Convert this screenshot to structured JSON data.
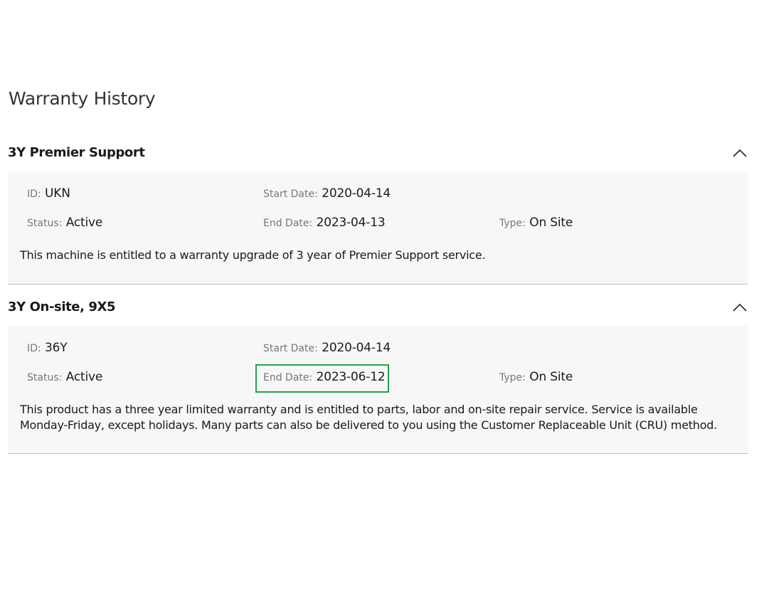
{
  "page": {
    "title": "Warranty History"
  },
  "warranties": [
    {
      "title": "3Y Premier Support",
      "id_label": "ID",
      "id_value": "UKN",
      "start_label": "Start Date",
      "start_value": "2020-04-14",
      "status_label": "Status",
      "status_value": "Active",
      "end_label": "End Date",
      "end_value": "2023-04-13",
      "type_label": "Type",
      "type_value": "On Site",
      "description": "This machine is entitled to a warranty upgrade of 3 year of Premier Support service.",
      "expanded_icon": "chevron-up-icon"
    },
    {
      "title": "3Y On-site, 9X5",
      "id_label": "ID",
      "id_value": "36Y",
      "start_label": "Start Date",
      "start_value": "2020-04-14",
      "status_label": "Status",
      "status_value": "Active",
      "end_label": "End Date",
      "end_value": "2023-06-12",
      "type_label": "Type",
      "type_value": "On Site",
      "description": "This product has a three year limited warranty and is entitled to parts, labor and on-site repair service. Service is available Monday-Friday, except holidays. Many parts can also be delivered to you using the Customer Replaceable Unit (CRU) method.",
      "expanded_icon": "chevron-up-icon"
    }
  ],
  "colors": {
    "highlight": "#22a34a",
    "panel_background": "#f7f7f7",
    "label_gray": "#777777"
  }
}
